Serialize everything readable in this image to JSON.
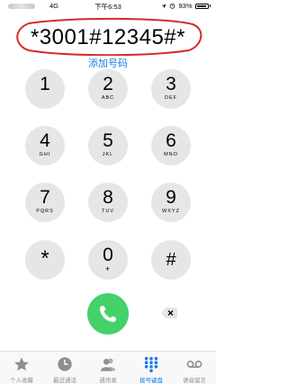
{
  "status_bar": {
    "network": "4G",
    "time": "下午6:53",
    "battery_percent": "93%",
    "battery_level": 0.93
  },
  "dialer": {
    "number": "*3001#12345#*",
    "add_number_label": "添加号码",
    "keys": [
      {
        "digit": "1",
        "letters": ""
      },
      {
        "digit": "2",
        "letters": "ABC"
      },
      {
        "digit": "3",
        "letters": "DEF"
      },
      {
        "digit": "4",
        "letters": "GHI"
      },
      {
        "digit": "5",
        "letters": "JKL"
      },
      {
        "digit": "6",
        "letters": "MNO"
      },
      {
        "digit": "7",
        "letters": "PQRS"
      },
      {
        "digit": "8",
        "letters": "TUV"
      },
      {
        "digit": "9",
        "letters": "WXYZ"
      },
      {
        "digit": "*",
        "letters": ""
      },
      {
        "digit": "0",
        "letters": "+"
      },
      {
        "digit": "#",
        "letters": ""
      }
    ]
  },
  "tabs": [
    {
      "label": "个人收藏",
      "icon": "star-icon"
    },
    {
      "label": "最近通话",
      "icon": "clock-icon"
    },
    {
      "label": "通讯录",
      "icon": "contacts-icon"
    },
    {
      "label": "拨号键盘",
      "icon": "keypad-icon",
      "active": true
    },
    {
      "label": "语音留言",
      "icon": "voicemail-icon"
    }
  ],
  "colors": {
    "accent": "#1a7ce6",
    "call_green": "#44d16a",
    "key_gray": "#e6e6e6",
    "annotation_red": "#d62a2a"
  }
}
